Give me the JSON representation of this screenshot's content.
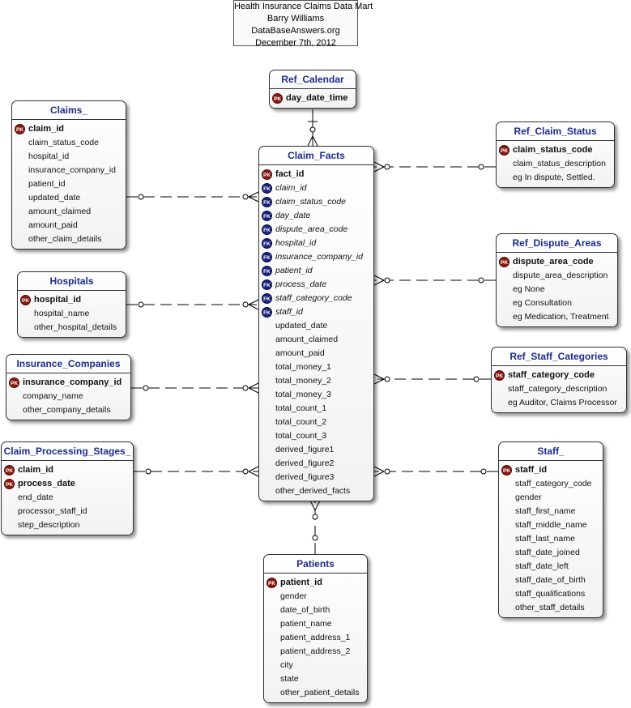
{
  "title_block": [
    "Health Insurance Claims Data Mart",
    "Barry Williams",
    "DataBaseAnswers.org",
    "December 7th. 2012"
  ],
  "entities": {
    "ref_calendar": {
      "name": "Ref_Calendar",
      "fields": [
        {
          "name": "day_date_time",
          "key": "PK"
        }
      ]
    },
    "claims": {
      "name": "Claims_",
      "fields": [
        {
          "name": "claim_id",
          "key": "PK"
        },
        {
          "name": "claim_status_code",
          "key": ""
        },
        {
          "name": "hospital_id",
          "key": ""
        },
        {
          "name": "insurance_company_id",
          "key": ""
        },
        {
          "name": "patient_id",
          "key": ""
        },
        {
          "name": "updated_date",
          "key": ""
        },
        {
          "name": "amount_claimed",
          "key": ""
        },
        {
          "name": "amount_paid",
          "key": ""
        },
        {
          "name": "other_claim_details",
          "key": ""
        }
      ]
    },
    "hospitals": {
      "name": "Hospitals",
      "fields": [
        {
          "name": "hospital_id",
          "key": "PK"
        },
        {
          "name": "hospital_name",
          "key": ""
        },
        {
          "name": "other_hospital_details",
          "key": ""
        }
      ]
    },
    "insurance_companies": {
      "name": "Insurance_Companies",
      "fields": [
        {
          "name": "insurance_company_id",
          "key": "PK"
        },
        {
          "name": "company_name",
          "key": ""
        },
        {
          "name": "other_company_details",
          "key": ""
        }
      ]
    },
    "claim_processing_stages": {
      "name": "Claim_Processing_Stages_",
      "fields": [
        {
          "name": "claim_id",
          "key": "PK"
        },
        {
          "name": "process_date",
          "key": "PK"
        },
        {
          "name": "end_date",
          "key": ""
        },
        {
          "name": "processor_staff_id",
          "key": ""
        },
        {
          "name": "step_description",
          "key": ""
        }
      ]
    },
    "claim_facts": {
      "name": "Claim_Facts",
      "fields": [
        {
          "name": "fact_id",
          "key": "PK"
        },
        {
          "name": "claim_id",
          "key": "FK"
        },
        {
          "name": "claim_status_code",
          "key": "FK"
        },
        {
          "name": "day_date",
          "key": "FK"
        },
        {
          "name": "dispute_area_code",
          "key": "FK"
        },
        {
          "name": "hospital_id",
          "key": "FK"
        },
        {
          "name": "insurance_company_id",
          "key": "FK"
        },
        {
          "name": "patient_id",
          "key": "FK"
        },
        {
          "name": "process_date",
          "key": "FK"
        },
        {
          "name": "staff_category_code",
          "key": "FK"
        },
        {
          "name": "staff_id",
          "key": "FK"
        },
        {
          "name": "updated_date",
          "key": ""
        },
        {
          "name": "amount_claimed",
          "key": ""
        },
        {
          "name": "amount_paid",
          "key": ""
        },
        {
          "name": "total_money_1",
          "key": ""
        },
        {
          "name": "total_money_2",
          "key": ""
        },
        {
          "name": "total_money_3",
          "key": ""
        },
        {
          "name": "total_count_1",
          "key": ""
        },
        {
          "name": "total_count_2",
          "key": ""
        },
        {
          "name": "total_count_3",
          "key": ""
        },
        {
          "name": "derived_figure1",
          "key": ""
        },
        {
          "name": "derived_figure2",
          "key": ""
        },
        {
          "name": "derived_figure3",
          "key": ""
        },
        {
          "name": "other_derived_facts",
          "key": ""
        }
      ]
    },
    "ref_claim_status": {
      "name": "Ref_Claim_Status",
      "fields": [
        {
          "name": "claim_status_code",
          "key": "PK"
        },
        {
          "name": "claim_status_description",
          "key": ""
        },
        {
          "name": "eg In dispute, Settled.",
          "key": ""
        }
      ]
    },
    "ref_dispute_areas": {
      "name": "Ref_Dispute_Areas",
      "fields": [
        {
          "name": "dispute_area_code",
          "key": "PK"
        },
        {
          "name": "dispute_area_description",
          "key": ""
        },
        {
          "name": "eg None",
          "key": ""
        },
        {
          "name": "eg Consultation",
          "key": ""
        },
        {
          "name": "eg Medication, Treatment",
          "key": ""
        }
      ]
    },
    "ref_staff_categories": {
      "name": "Ref_Staff_Categories",
      "fields": [
        {
          "name": "staff_category_code",
          "key": "PK"
        },
        {
          "name": "staff_category_description",
          "key": ""
        },
        {
          "name": "eg Auditor, Claims Processor",
          "key": ""
        }
      ]
    },
    "staff": {
      "name": "Staff_",
      "fields": [
        {
          "name": "staff_id",
          "key": "PK"
        },
        {
          "name": "staff_category_code",
          "key": ""
        },
        {
          "name": "gender",
          "key": ""
        },
        {
          "name": "staff_first_name",
          "key": ""
        },
        {
          "name": "staff_middle_name",
          "key": ""
        },
        {
          "name": "staff_last_name",
          "key": ""
        },
        {
          "name": "staff_date_joined",
          "key": ""
        },
        {
          "name": "staff_date_left",
          "key": ""
        },
        {
          "name": "staff_date_of_birth",
          "key": ""
        },
        {
          "name": "staff_qualifications",
          "key": ""
        },
        {
          "name": "other_staff_details",
          "key": ""
        }
      ]
    },
    "patients": {
      "name": "Patients",
      "fields": [
        {
          "name": "patient_id",
          "key": "PK"
        },
        {
          "name": "gender",
          "key": ""
        },
        {
          "name": "date_of_birth",
          "key": ""
        },
        {
          "name": "patient_name",
          "key": ""
        },
        {
          "name": "patient_address_1",
          "key": ""
        },
        {
          "name": "patient_address_2",
          "key": ""
        },
        {
          "name": "city",
          "key": ""
        },
        {
          "name": "state",
          "key": ""
        },
        {
          "name": "other_patient_details",
          "key": ""
        }
      ]
    }
  },
  "relationships": [
    {
      "parent": "Ref_Calendar",
      "child": "Claim_Facts"
    },
    {
      "parent": "Claims_",
      "child": "Claim_Facts"
    },
    {
      "parent": "Hospitals",
      "child": "Claim_Facts"
    },
    {
      "parent": "Insurance_Companies",
      "child": "Claim_Facts"
    },
    {
      "parent": "Claim_Processing_Stages_",
      "child": "Claim_Facts"
    },
    {
      "parent": "Ref_Claim_Status",
      "child": "Claim_Facts"
    },
    {
      "parent": "Ref_Dispute_Areas",
      "child": "Claim_Facts"
    },
    {
      "parent": "Ref_Staff_Categories",
      "child": "Claim_Facts"
    },
    {
      "parent": "Staff_",
      "child": "Claim_Facts"
    },
    {
      "parent": "Patients",
      "child": "Claim_Facts"
    }
  ],
  "key_badges": {
    "pk": "PK",
    "fk": "FK"
  },
  "colors": {
    "title_text": "#1d2b8e",
    "pk_badge": "#8b1a10",
    "fk_badge": "#1a237e",
    "line": "#000000"
  }
}
